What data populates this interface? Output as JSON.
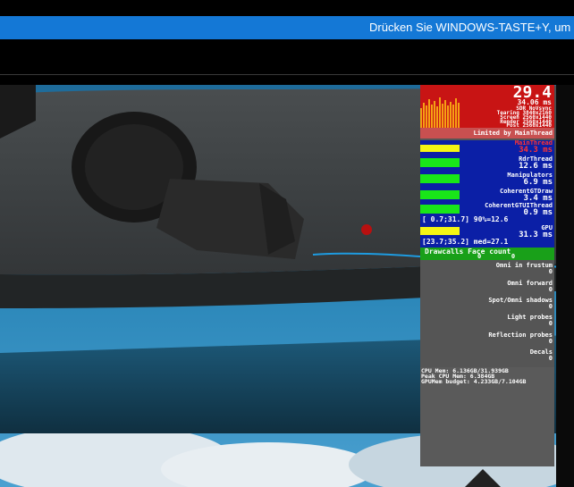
{
  "notification": {
    "text": "Drücken Sie WINDOWS-TASTE+Y, um sta"
  },
  "overlay": {
    "fps": "29.4",
    "frame_ms": "34.06 ms",
    "sub_lines": [
      "SDR NoVsync",
      "Tearing 3840x2160",
      "Screen 2560x1440",
      "Render 2560x1440",
      "Post 2560x1440"
    ],
    "limited": "Limited by MainThread",
    "threads": [
      {
        "name": "MainThread",
        "value": "34.3 ms",
        "name_color": "#ff3333"
      },
      {
        "name": "RdrThread",
        "value": "12.6 ms",
        "name_color": "#ffffff"
      },
      {
        "name": "Manipulators",
        "value": "6.9 ms",
        "name_color": "#ffffff"
      },
      {
        "name": "CoherentGTDraw",
        "value": "3.4 ms",
        "name_color": "#ffffff"
      },
      {
        "name": "CoherentGTUIThread",
        "value": "0.9 ms",
        "name_color": "#ffffff"
      }
    ],
    "range1": "[ 0.7;31.7] 90%=12.6",
    "gpu_label": "GPU",
    "gpu_value": "31.3 ms",
    "range2": "[23.7;35.2] med=27.1",
    "drawcalls_label": "Drawcalls Face count",
    "drawcalls_values": "0        0",
    "stats": [
      {
        "label": "Omni in frustum",
        "value": "0"
      },
      {
        "label": "Omni forward",
        "value": "0"
      },
      {
        "label": "Spot/Omni shadows",
        "value": "0"
      },
      {
        "label": "Light probes",
        "value": "0"
      },
      {
        "label": "Reflection probes",
        "value": "0"
      },
      {
        "label": "Decals",
        "value": "0"
      }
    ],
    "memory": [
      "CPU Mem: 6.136GB/31.939GB",
      "Peak CPU Mem: 6.384GB",
      "GPUMem budget: 4.233GB/7.104GB"
    ]
  }
}
